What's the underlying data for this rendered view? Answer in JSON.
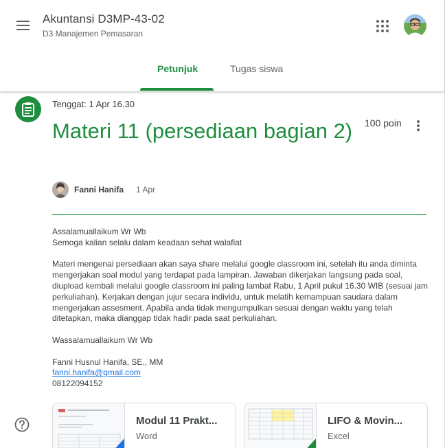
{
  "header": {
    "class_title": "Akuntansi D3MP-43-02",
    "class_subtitle": "D3 Manajemen Pemasaran",
    "tabs": [
      {
        "label": "Petunjuk",
        "active": true
      },
      {
        "label": "Tugas siswa",
        "active": false
      }
    ]
  },
  "assignment": {
    "due": "Tenggat: 1 Apr 16.30",
    "title": "Materi 11 (persediaan bagian 2)",
    "points": "100 poin",
    "author": "Fanni Hanifa",
    "posted_date": "1 Apr"
  },
  "description": {
    "greeting_1": "Assalamuallaikum Wr Wb",
    "greeting_2": "Semoga kalian selalu dalam keadaan sehat walafiat",
    "paragraph": "Materi mengenai persediaan akan saya share melalui google classroom ini, setelah itu anda diminta mengerjakan soal modul yang terdapat pada lampiran. Jawaban dikerjakan langsung pada soal, diupload kembali melalui google classroom ini paling lambat Rabu, 1 April pukul 16.30 WIB (sesuai jam perkuliahan). Kerjakan dengan jujur secara individu, untuk melatih kemampuan saudara dalam mengerjakan assesment. Apabila anda tidak mengumpulkan sesuai dengan waktu yang telah ditetapkan, maka dianggap tidak hadir pada saat perkuliahan.",
    "closing": "Wassalamuallaikum Wr Wb",
    "signature_name": "Fanni Husnul Hanifa, SE., MM",
    "email": "fanni.hanifa@gmail.com",
    "phone": "08122094152"
  },
  "attachments": [
    {
      "title": "Modul 11 Prakt...",
      "type": "Word",
      "corner_color": "#1a73e8"
    },
    {
      "title": "LIFO & Movin...",
      "type": "Excel",
      "corner_color": "#1e8e3e"
    }
  ],
  "colors": {
    "accent": "#1e8e3e",
    "link": "#1a73e8"
  },
  "icons": [
    "menu-icon",
    "apps-grid-icon",
    "assignment-icon",
    "more-vert-icon",
    "help-icon"
  ]
}
